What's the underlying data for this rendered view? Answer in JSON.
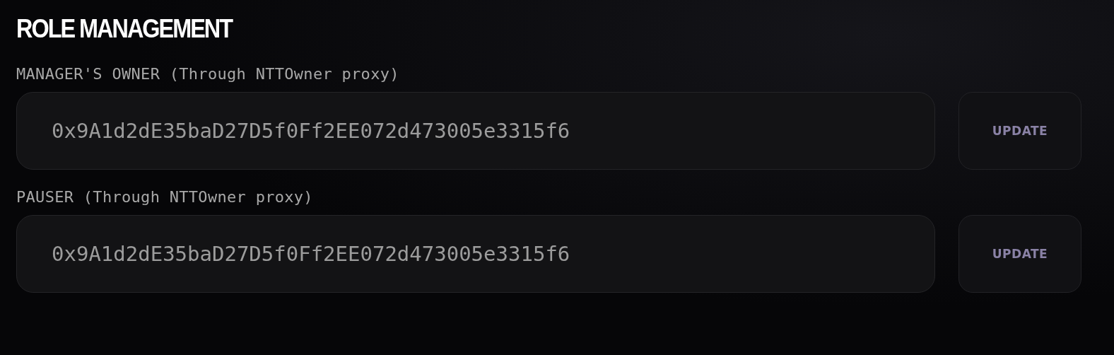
{
  "title": "ROLE MANAGEMENT",
  "roles": [
    {
      "label": "MANAGER'S OWNER (Through NTTOwner proxy)",
      "value": "0x9A1d2dE35baD27D5f0Ff2EE072d473005e3315f6",
      "button": "UPDATE"
    },
    {
      "label": "PAUSER (Through NTTOwner proxy)",
      "value": "0x9A1d2dE35baD27D5f0Ff2EE072d473005e3315f6",
      "button": "UPDATE"
    }
  ]
}
